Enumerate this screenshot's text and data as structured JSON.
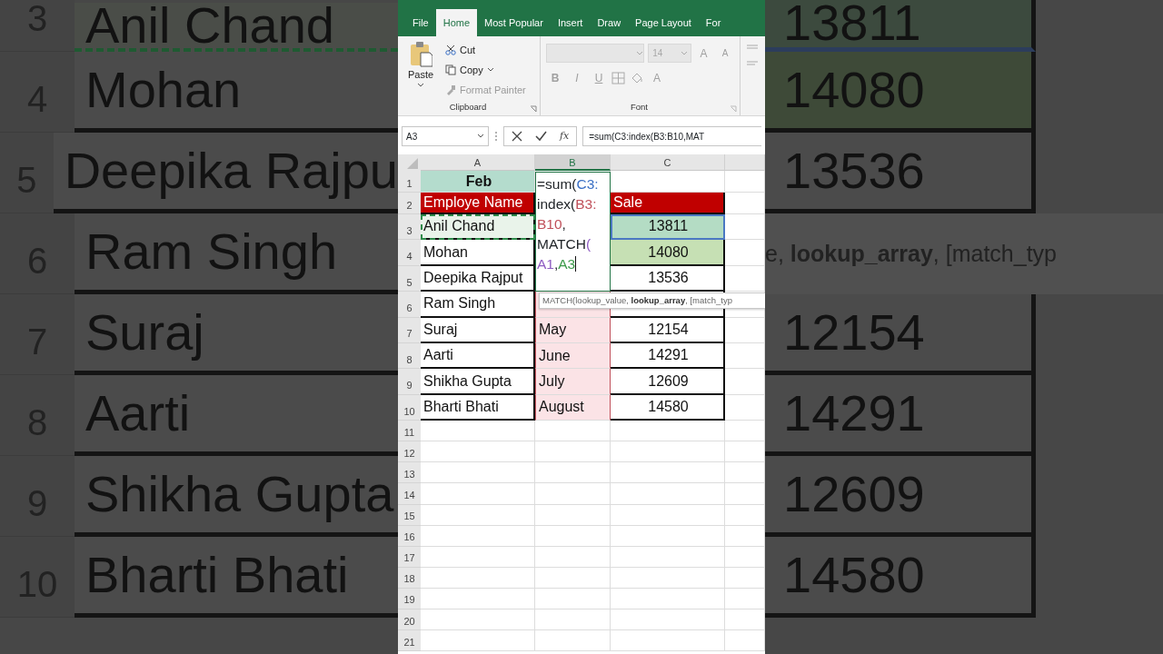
{
  "backdrop_left": {
    "rows": [
      {
        "row": "3",
        "name": "Anil Chand",
        "marquee": true
      },
      {
        "row": "4",
        "name": "Mohan",
        "marquee": false
      },
      {
        "row": "5",
        "name": "Deepika Rajpu",
        "marquee": false
      },
      {
        "row": "6",
        "name": "Ram Singh",
        "marquee": false
      },
      {
        "row": "7",
        "name": "Suraj",
        "marquee": false
      },
      {
        "row": "8",
        "name": "Aarti",
        "marquee": false
      },
      {
        "row": "9",
        "name": "Shikha Gupta",
        "marquee": false
      },
      {
        "row": "10",
        "name": "Bharti Bhati",
        "marquee": false
      }
    ]
  },
  "ribbon": {
    "tabs": [
      {
        "label": "File",
        "selected": false
      },
      {
        "label": "Home",
        "selected": true
      },
      {
        "label": "Most Popular",
        "selected": false
      },
      {
        "label": "Insert",
        "selected": false
      },
      {
        "label": "Draw",
        "selected": false
      },
      {
        "label": "Page Layout",
        "selected": false
      },
      {
        "label": "For",
        "selected": false
      }
    ],
    "clipboard": {
      "paste": "Paste",
      "cut": "Cut",
      "copy": "Copy",
      "format_painter": "Format Painter",
      "format_painter_disabled": true,
      "label": "Clipboard"
    },
    "font": {
      "size": "14",
      "grow": "A",
      "shrink": "A",
      "bold": "B",
      "italic": "I",
      "underline": "U",
      "font_color": "A",
      "label": "Font",
      "disabled": true
    }
  },
  "formula_bar": {
    "name_box": "A3",
    "function_glyph": "fx",
    "formula": "=sum(C3:index(B3:B10,MAT"
  },
  "sheet": {
    "columns": [
      {
        "label": "A",
        "selected": false
      },
      {
        "label": "B",
        "selected": true
      },
      {
        "label": "C",
        "selected": false
      }
    ],
    "title_row": {
      "row": "1",
      "a": "Feb"
    },
    "rows": [
      {
        "row": "2",
        "kind": "header",
        "a": "Employe Name",
        "c": "Sale",
        "marquee": false,
        "outlined": false
      },
      {
        "row": "3",
        "kind": "data",
        "a": "Anil Chand",
        "c": "13811",
        "color": "#b4dcc4",
        "marquee": true,
        "outlined": true
      },
      {
        "row": "4",
        "kind": "data",
        "a": "Mohan",
        "c": "14080",
        "color": "#c6e0b4",
        "marquee": false,
        "outlined": false
      },
      {
        "row": "5",
        "kind": "data",
        "a": "Deepika Rajput",
        "c": "13536",
        "marquee": false,
        "outlined": false
      },
      {
        "row": "6",
        "kind": "data",
        "a": "Ram Singh",
        "marquee": false,
        "outlined": false
      },
      {
        "row": "7",
        "kind": "data",
        "a": "Suraj",
        "b": "May",
        "c": "12154",
        "marquee": false,
        "outlined": false
      },
      {
        "row": "8",
        "kind": "data",
        "a": "Aarti",
        "b": "June",
        "c": "14291",
        "marquee": false,
        "outlined": false
      },
      {
        "row": "9",
        "kind": "data",
        "a": "Shikha Gupta",
        "b": "July",
        "c": "12609",
        "marquee": false,
        "outlined": false
      },
      {
        "row": "10",
        "kind": "data",
        "a": "Bharti Bhati",
        "b": "August",
        "c": "14580",
        "marquee": false,
        "outlined": false
      }
    ],
    "empty_rows": [
      "11",
      "12",
      "13",
      "14",
      "15",
      "16",
      "17",
      "18",
      "19",
      "20",
      "21"
    ],
    "editor": {
      "lines": [
        [
          {
            "text": "=sum("
          },
          {
            "text": "C3:",
            "color": "#3a6fc4"
          }
        ],
        [
          {
            "text": "index("
          },
          {
            "text": "B3:",
            "color": "#c0505a"
          }
        ],
        [
          {
            "text": "B10",
            "color": "#c0505a"
          },
          {
            "text": ","
          }
        ],
        [
          {
            "text": "MATCH"
          },
          {
            "text": "(",
            "color": "#8e5cc2"
          }
        ],
        [
          {
            "text": "A1",
            "color": "#8e5cc2"
          },
          {
            "text": ","
          },
          {
            "text": "A3",
            "color": "#3c9a4a"
          }
        ]
      ]
    },
    "tooltip": "MATCH(lookup_value, **lookup_array**, [match_typ"
  },
  "backdrop_right": {
    "rows": [
      {
        "kind": "value",
        "text": "13811",
        "color": "#3c4a3e"
      },
      {
        "kind": "value",
        "text": "14080",
        "color": "#3e4a38"
      },
      {
        "kind": "value",
        "text": "13536"
      },
      {
        "kind": "tooltip",
        "text": "e, **lookup_array**, [match_typ"
      },
      {
        "kind": "value",
        "text": "12154"
      },
      {
        "kind": "value",
        "text": "14291"
      },
      {
        "kind": "value",
        "text": "12609"
      },
      {
        "kind": "value",
        "text": "14580"
      }
    ]
  }
}
